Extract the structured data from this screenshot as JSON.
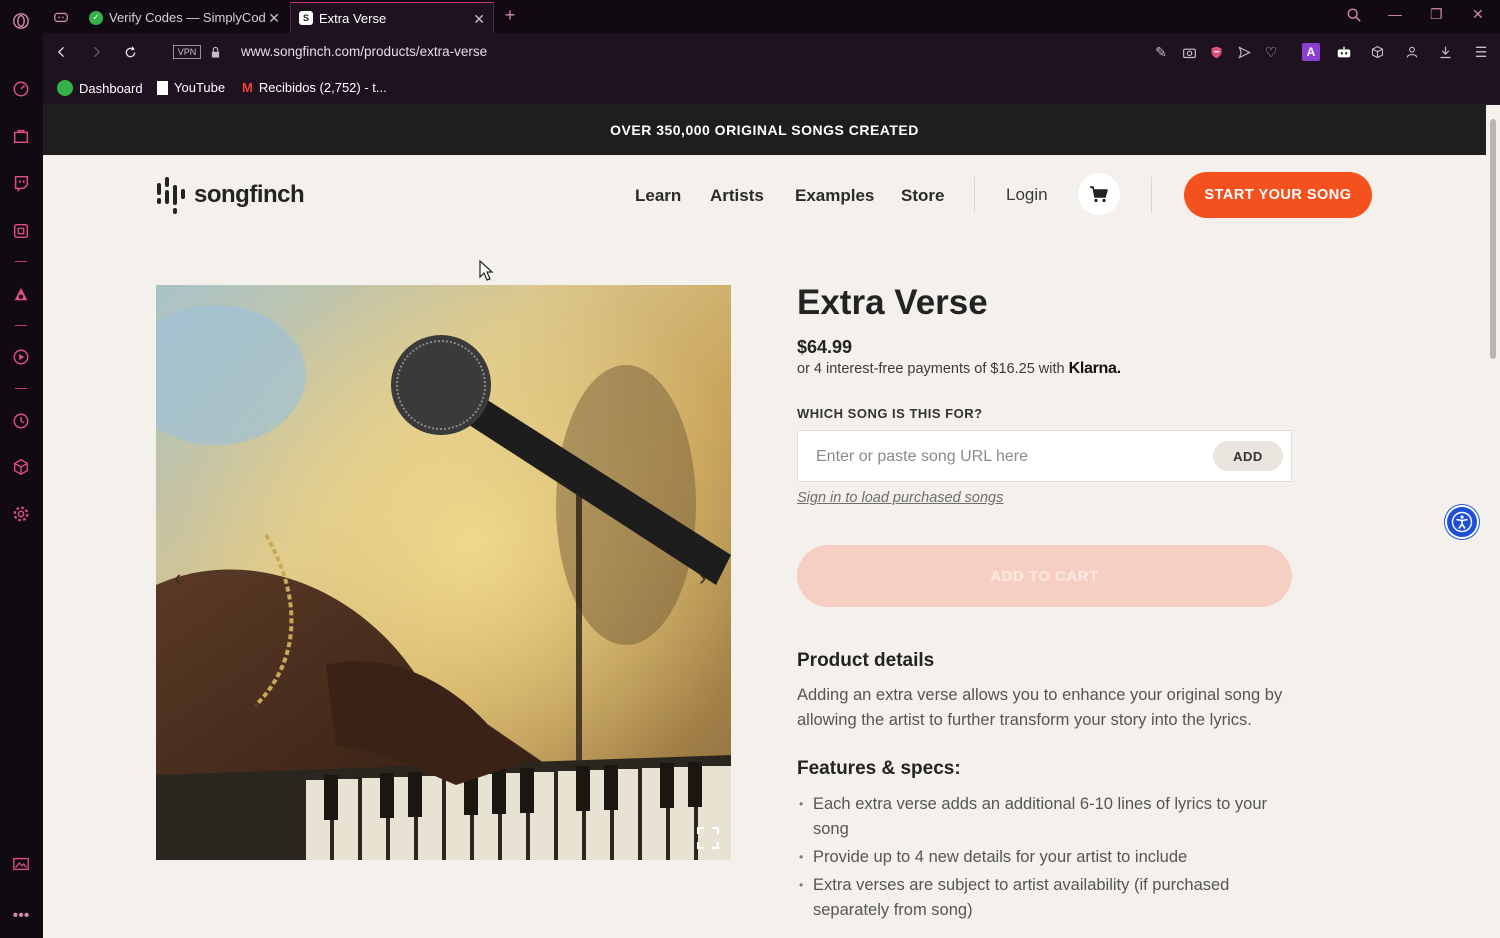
{
  "browser": {
    "tabs": [
      {
        "title": "Verify Codes — SimplyCod"
      },
      {
        "title": "Extra Verse"
      }
    ],
    "url": "www.songfinch.com/products/extra-verse",
    "vpn_label": "VPN",
    "bookmarks": [
      {
        "label": "Dashboard"
      },
      {
        "label": "YouTube"
      },
      {
        "label": "Recibidos (2,752) - t..."
      }
    ],
    "colors": {
      "accent": "#c83a6a",
      "chrome_bg": "#120a13"
    }
  },
  "site": {
    "announcement": "OVER 350,000 ORIGINAL SONGS CREATED",
    "logo_text": "songfinch",
    "nav": [
      {
        "label": "Learn"
      },
      {
        "label": "Artists"
      },
      {
        "label": "Examples"
      },
      {
        "label": "Store"
      }
    ],
    "login_label": "Login",
    "cta_label": "START YOUR SONG",
    "brand_color": "#f4511e"
  },
  "product": {
    "title": "Extra Verse",
    "price": "$64.99",
    "klarna_text": "or 4 interest-free payments of $16.25 with",
    "klarna_brand": "Klarna.",
    "song_question": "WHICH SONG IS THIS FOR?",
    "song_input_placeholder": "Enter or paste song URL here",
    "add_label": "ADD",
    "signin_link": "Sign in to load purchased songs",
    "add_to_cart_label": "ADD TO CART",
    "details_heading": "Product details",
    "details_text": "Adding an extra verse allows you to enhance your original song by allowing the artist to further transform your story into the lyrics.",
    "features_heading": "Features & specs:",
    "features": [
      "Each extra verse adds an additional 6-10 lines of lyrics to your song",
      "Provide up to 4 new details for your artist to include",
      "Extra verses are subject to artist availability (if purchased separately from song)"
    ]
  }
}
